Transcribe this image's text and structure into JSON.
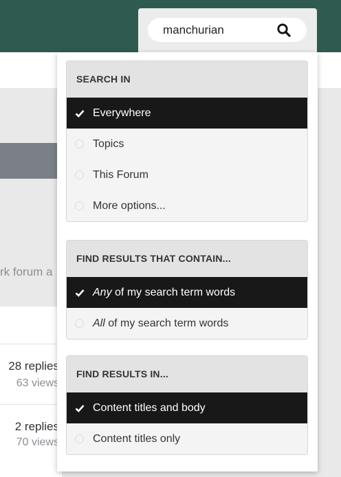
{
  "search": {
    "query": "manchurian",
    "button_icon": "search-icon"
  },
  "background": {
    "text_fragment": "rk forum a",
    "threads": [
      {
        "replies": "28 replies",
        "views": "63 views"
      },
      {
        "replies": "2 replies",
        "views": "70 views"
      }
    ]
  },
  "dropdown": {
    "search_in": {
      "title": "SEARCH IN",
      "options": [
        {
          "label": "Everywhere",
          "selected": true
        },
        {
          "label": "Topics",
          "selected": false
        },
        {
          "label": "This Forum",
          "selected": false
        },
        {
          "label": "More options...",
          "selected": false
        }
      ]
    },
    "contain": {
      "title": "FIND RESULTS THAT CONTAIN...",
      "options": [
        {
          "emphasis": "Any",
          "rest": " of my search term words",
          "selected": true
        },
        {
          "emphasis": "All",
          "rest": " of my search term words",
          "selected": false
        }
      ]
    },
    "results_in": {
      "title": "FIND RESULTS IN...",
      "options": [
        {
          "label": "Content titles and body",
          "selected": true
        },
        {
          "label": "Content titles only",
          "selected": false
        }
      ]
    }
  },
  "colors": {
    "header_bg": "#2e5a50",
    "selected_bg": "#181818",
    "muted_text": "#8a8f95"
  }
}
